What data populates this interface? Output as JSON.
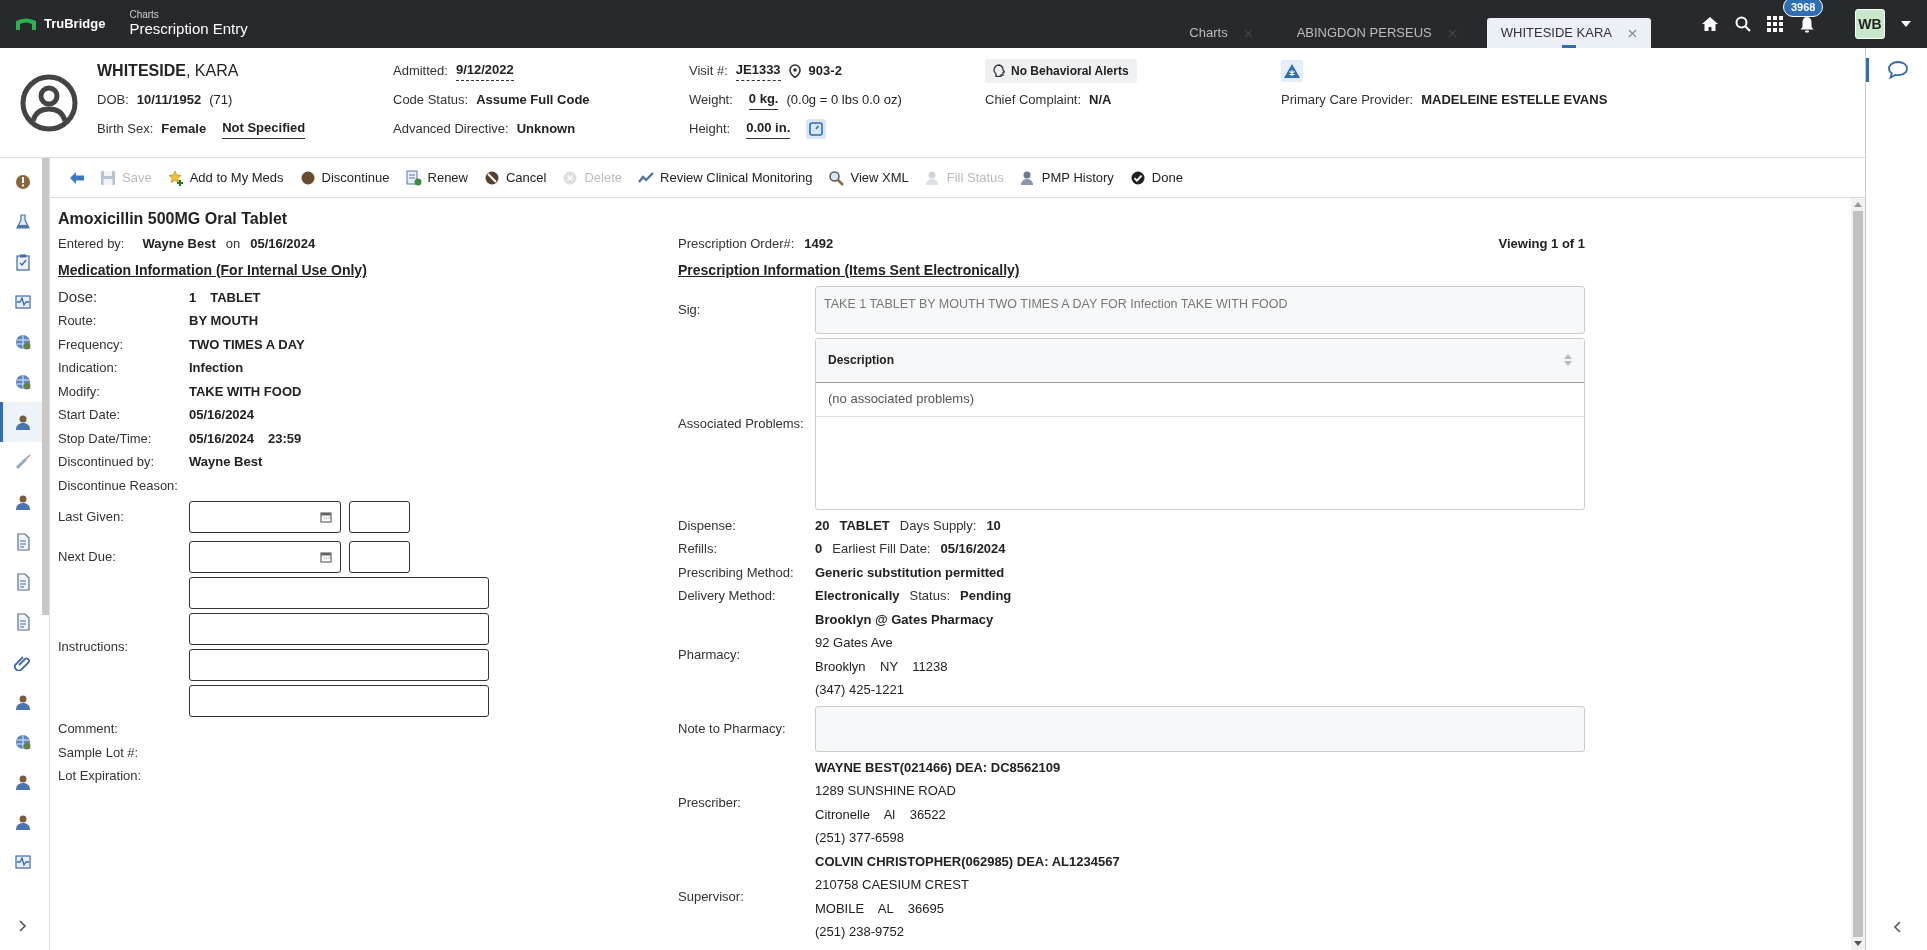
{
  "app": {
    "brand": "TruBridge",
    "section": "Charts",
    "title": "Prescription Entry"
  },
  "tabs": [
    {
      "label": "Charts",
      "selected": false
    },
    {
      "label": "ABINGDON PERSEUS",
      "selected": false
    },
    {
      "label": "WHITESIDE KARA",
      "selected": true
    }
  ],
  "notifications": {
    "count": "3968"
  },
  "user": {
    "initials": "WB"
  },
  "patient_header": {
    "columns": [
      {
        "rows": [
          {
            "parts": [
              {
                "kind": "name",
                "text": "**WHITESIDE**, KARA"
              }
            ]
          },
          {
            "label": "DOB:",
            "parts": [
              {
                "kind": "bold",
                "text": "10/11/1952"
              },
              {
                "kind": "normal",
                "text": "(71)"
              }
            ]
          },
          {
            "label": "Birth Sex:",
            "parts": [
              {
                "kind": "bold",
                "text": "Female"
              },
              {
                "kind": "underline",
                "text": "Not Specified"
              }
            ]
          }
        ]
      },
      {
        "rows": [
          {
            "label": "Admitted:",
            "parts": [
              {
                "kind": "dashed",
                "text": "9/12/2022"
              }
            ]
          },
          {
            "label": "Code Status:",
            "parts": [
              {
                "kind": "bold",
                "text": "Assume Full Code"
              }
            ]
          },
          {
            "label": "Advanced Directive:",
            "parts": [
              {
                "kind": "bold",
                "text": "Unknown"
              }
            ]
          }
        ]
      },
      {
        "rows": [
          {
            "label": "Visit #:",
            "parts": [
              {
                "kind": "dashed",
                "text": "JE1333"
              },
              {
                "kind": "location",
                "text": "903-2"
              }
            ]
          },
          {
            "label": "Weight:",
            "parts": [
              {
                "kind": "underline",
                "text": "0 kg."
              },
              {
                "kind": "normal",
                "text": "(0.0g = 0 lbs 0.0 oz)"
              }
            ]
          },
          {
            "label": "Height:",
            "parts": [
              {
                "kind": "underline",
                "text": "0.00 in."
              },
              {
                "kind": "scale_button"
              }
            ]
          }
        ]
      },
      {
        "rows": [
          {
            "parts": [
              {
                "kind": "chip",
                "text": "No Behavioral Alerts"
              }
            ]
          },
          {
            "label": "Chief Complaint:",
            "parts": [
              {
                "kind": "bold",
                "text": "N/A"
              }
            ]
          }
        ]
      },
      {
        "rows": [
          {
            "parts": [
              {
                "kind": "alert_badge"
              }
            ]
          },
          {
            "label": "Primary Care Provider:",
            "parts": [
              {
                "kind": "bold",
                "text": "MADELEINE ESTELLE EVANS"
              }
            ]
          }
        ]
      }
    ]
  },
  "sidebar": {
    "items": [
      {
        "selected": false
      },
      {
        "selected": false
      },
      {
        "selected": false
      },
      {
        "selected": false
      },
      {
        "selected": false
      },
      {
        "selected": false
      },
      {
        "selected": true
      },
      {
        "selected": false
      },
      {
        "selected": false
      },
      {
        "selected": false
      },
      {
        "selected": false
      },
      {
        "selected": false
      },
      {
        "selected": false
      },
      {
        "selected": false
      },
      {
        "selected": false
      },
      {
        "selected": false
      },
      {
        "selected": false
      },
      {
        "selected": false
      }
    ]
  },
  "toolbar": {
    "items": [
      {
        "label": "Save",
        "disabled": true
      },
      {
        "label": "Add to My Meds",
        "disabled": false
      },
      {
        "label": "Discontinue",
        "disabled": false
      },
      {
        "label": "Renew",
        "disabled": false
      },
      {
        "label": "Cancel",
        "disabled": false
      },
      {
        "label": "Delete",
        "disabled": true
      },
      {
        "label": "Review Clinical Monitoring",
        "disabled": false
      },
      {
        "label": "View XML",
        "disabled": false
      },
      {
        "label": "Fill Status",
        "disabled": true
      },
      {
        "label": "PMP History",
        "disabled": false
      },
      {
        "label": "Done",
        "disabled": false
      }
    ]
  },
  "medication": {
    "title": "Amoxicillin 500MG Oral Tablet",
    "entered_by": {
      "label": "Entered by:",
      "name": "Wayne Best",
      "connector": "on",
      "date": "05/16/2024"
    },
    "heading": "Medication Information (For Internal Use Only)",
    "fields": [
      {
        "label": "Dose:",
        "kind": "text",
        "large": true,
        "values": [
          "1",
          "TABLET"
        ]
      },
      {
        "label": "Route:",
        "kind": "text",
        "values": [
          "BY MOUTH"
        ]
      },
      {
        "label": "Frequency:",
        "kind": "text",
        "values": [
          "TWO TIMES A DAY"
        ]
      },
      {
        "label": "Indication:",
        "kind": "text",
        "values": [
          "Infection"
        ]
      },
      {
        "label": "Modify:",
        "kind": "text",
        "values": [
          "TAKE WITH FOOD"
        ]
      },
      {
        "label": "Start Date:",
        "kind": "text",
        "values": [
          "05/16/2024"
        ]
      },
      {
        "label": "Stop Date/Time:",
        "kind": "text",
        "values": [
          "05/16/2024",
          "23:59"
        ]
      },
      {
        "label": "Discontinued by:",
        "kind": "text",
        "values": [
          "Wayne Best"
        ]
      },
      {
        "label": "Discontinue Reason:",
        "kind": "text"
      },
      {
        "label": "Last Given:",
        "kind": "inputs",
        "inputs": [
          {
            "kind": "date"
          },
          {
            "kind": "time"
          }
        ]
      },
      {
        "label": "Next Due:",
        "kind": "inputs",
        "inputs": [
          {
            "kind": "date"
          },
          {
            "kind": "time"
          }
        ]
      },
      {
        "label": "Instructions:",
        "kind": "stack",
        "inputs": [
          {
            "kind": "line"
          },
          {
            "kind": "line"
          },
          {
            "kind": "line"
          },
          {
            "kind": "line"
          }
        ]
      },
      {
        "label": "Comment:",
        "kind": "text"
      },
      {
        "label": "Sample Lot #:",
        "kind": "text"
      },
      {
        "label": "Lot Expiration:",
        "kind": "text"
      }
    ]
  },
  "prescription": {
    "order": {
      "label": "Prescription Order#:",
      "value": "1492"
    },
    "viewing": "Viewing 1 of 1",
    "heading": "Prescription Information (Items Sent Electronically)",
    "rows": [
      {
        "label": "Sig:",
        "kind": "textarea",
        "value": "TAKE 1 TABLET BY MOUTH TWO TIMES A DAY FOR Infection TAKE WITH FOOD"
      },
      {
        "label": "Associated Problems:",
        "kind": "table",
        "column": "Description",
        "empty_text": "(no associated problems)"
      },
      {
        "label": "Dispense:",
        "kind": "inline",
        "parts": [
          {
            "text": "20",
            "bold": true
          },
          {
            "text": "TABLET",
            "bold": true
          },
          {
            "text": "Days Supply:",
            "bold": false
          },
          {
            "text": "10",
            "bold": true
          }
        ]
      },
      {
        "label": "Refills:",
        "kind": "inline",
        "parts": [
          {
            "text": "0",
            "bold": true
          },
          {
            "text": "Earliest Fill Date:",
            "bold": false
          },
          {
            "text": "05/16/2024",
            "bold": true
          }
        ]
      },
      {
        "label": "Prescribing Method:",
        "kind": "inline",
        "parts": [
          {
            "text": "Generic substitution permitted",
            "bold": true
          }
        ]
      },
      {
        "label": "Delivery Method:",
        "kind": "inline",
        "parts": [
          {
            "text": "Electronically",
            "bold": true
          },
          {
            "text": "Status:",
            "bold": false
          },
          {
            "text": "Pending",
            "bold": true
          }
        ]
      },
      {
        "label": "Pharmacy:",
        "kind": "lines",
        "lines": [
          {
            "text": "Brooklyn @ Gates Pharmacy",
            "bold": true
          },
          {
            "text": "92 Gates Ave",
            "bold": false
          },
          {
            "text": "Brooklyn    NY    11238",
            "bold": false
          },
          {
            "text": "(347) 425-1221",
            "bold": false
          }
        ]
      },
      {
        "label": "Note to Pharmacy:",
        "kind": "box"
      },
      {
        "label": "Prescriber:",
        "kind": "lines",
        "lines": [
          {
            "text": "WAYNE BEST(021466) DEA: DC8562109",
            "bold": true
          },
          {
            "text": "1289 SUNSHINE ROAD",
            "bold": false
          },
          {
            "text": "Citronelle    Al    36522",
            "bold": false
          },
          {
            "text": "(251) 377-6598",
            "bold": false
          }
        ]
      },
      {
        "label": "Supervisor:",
        "kind": "lines",
        "lines": [
          {
            "text": "COLVIN CHRISTOPHER(062985) DEA: AL1234567",
            "bold": true
          },
          {
            "text": "210758 CAESIUM CREST",
            "bold": false
          },
          {
            "text": "MOBILE    AL    36695",
            "bold": false
          },
          {
            "text": "(251) 238-9752",
            "bold": false
          }
        ]
      }
    ]
  }
}
